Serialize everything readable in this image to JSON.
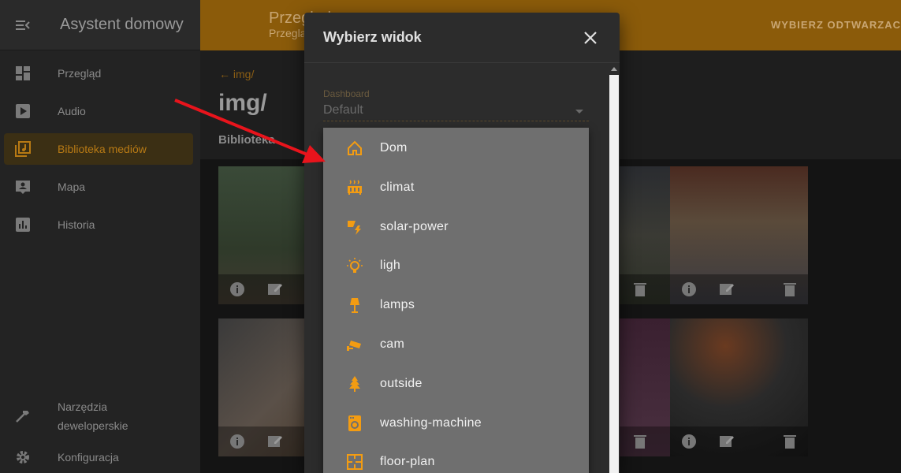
{
  "sidebar": {
    "title": "Asystent domowy",
    "items": [
      {
        "label": "Przegląd",
        "icon": "dashboard-icon"
      },
      {
        "label": "Audio",
        "icon": "play-box-icon"
      },
      {
        "label": "Biblioteka mediów",
        "icon": "media-library-icon",
        "active": true
      },
      {
        "label": "Mapa",
        "icon": "map-person-icon"
      },
      {
        "label": "Historia",
        "icon": "chart-box-icon"
      },
      {
        "label": "Narzędzia",
        "label2": "deweloperskie",
        "icon": "hammer-icon"
      },
      {
        "label": "Konfiguracja",
        "icon": "gear-icon"
      }
    ]
  },
  "header": {
    "title": "Przegląd",
    "subtitle": "Przeglą",
    "action": "WYBIERZ ODTWARZAC"
  },
  "content": {
    "back_label": "img/",
    "page_title": "img/",
    "section_label": "Biblioteka"
  },
  "dialog": {
    "title": "Wybierz widok",
    "field_label": "Dashboard",
    "field_value": "Default",
    "options": [
      {
        "label": "Dom",
        "icon": "home-icon"
      },
      {
        "label": "climat",
        "icon": "radiator-icon"
      },
      {
        "label": "solar-power",
        "icon": "solar-power-icon"
      },
      {
        "label": "ligh",
        "icon": "lightbulb-icon"
      },
      {
        "label": "lamps",
        "icon": "floor-lamp-icon"
      },
      {
        "label": "cam",
        "icon": "cctv-icon"
      },
      {
        "label": "outside",
        "icon": "pine-tree-icon"
      },
      {
        "label": "washing-machine",
        "icon": "washing-machine-icon"
      },
      {
        "label": "floor-plan",
        "icon": "floor-plan-icon"
      }
    ]
  },
  "colors": {
    "accent": "#f39c12",
    "header_bg": "#8b5b0a",
    "menu_bg": "#6f6f6f",
    "arrow": "#e8141c"
  }
}
